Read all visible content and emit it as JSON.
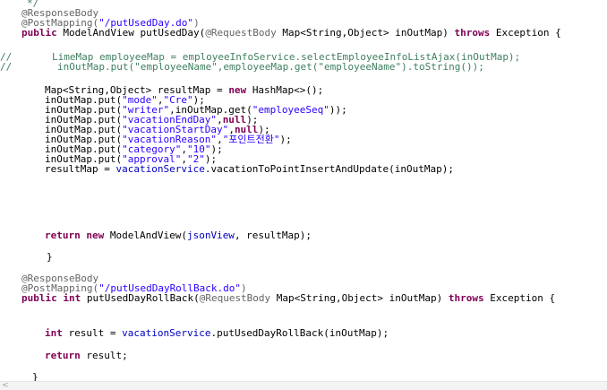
{
  "editor": {
    "language": "java",
    "colors": {
      "background": "#ffffff",
      "annotation": "#646464",
      "keyword": "#7f0055",
      "string": "#2a00ff",
      "comment": "#3f7f5f",
      "field": "#0000c0",
      "plain": "#000000"
    },
    "lines": [
      [
        {
          "t": "comment",
          "v": "*/"
        }
      ],
      [
        {
          "t": "annotation",
          "v": "@ResponseBody"
        }
      ],
      [
        {
          "t": "annotation",
          "v": "@PostMapping("
        },
        {
          "t": "string",
          "v": "\"/putUsedDay.do\""
        },
        {
          "t": "annotation",
          "v": ")"
        }
      ],
      [
        {
          "t": "keyword",
          "v": "public "
        },
        {
          "t": "plain",
          "v": "ModelAndView putUsedDay("
        },
        {
          "t": "annotation",
          "v": "@RequestBody "
        },
        {
          "t": "plain",
          "v": "Map<String,Object> "
        },
        {
          "t": "plain",
          "v": "inOutMap) "
        },
        {
          "t": "keyword",
          "v": "throws "
        },
        {
          "t": "plain",
          "v": "Exception {"
        }
      ],
      [],
      [
        {
          "t": "comment",
          "v": "LimeMap employeeMap = employeeInfoService.selectEmployeeInfoListAjax(inOutMap);"
        }
      ],
      [
        {
          "t": "comment",
          "v": "inOutMap.put(\"employeeName\",employeeMap.get(\"employeeName\").toString());"
        }
      ],
      [],
      [
        {
          "t": "plain",
          "v": "Map<String,Object> resultMap = "
        },
        {
          "t": "keyword",
          "v": "new "
        },
        {
          "t": "plain",
          "v": "HashMap<>();"
        }
      ],
      [
        {
          "t": "plain",
          "v": "inOutMap.put("
        },
        {
          "t": "string",
          "v": "\"mode\""
        },
        {
          "t": "plain",
          "v": ","
        },
        {
          "t": "string",
          "v": "\"Cre\""
        },
        {
          "t": "plain",
          "v": ");"
        }
      ],
      [
        {
          "t": "plain",
          "v": "inOutMap.put("
        },
        {
          "t": "string",
          "v": "\"writer\""
        },
        {
          "t": "plain",
          "v": ",inOutMap.get("
        },
        {
          "t": "string",
          "v": "\"employeeSeq\""
        },
        {
          "t": "plain",
          "v": "));"
        }
      ],
      [
        {
          "t": "plain",
          "v": "inOutMap.put("
        },
        {
          "t": "string",
          "v": "\"vacationEndDay\""
        },
        {
          "t": "plain",
          "v": ","
        },
        {
          "t": "keyword",
          "v": "null"
        },
        {
          "t": "plain",
          "v": ");"
        }
      ],
      [
        {
          "t": "plain",
          "v": "inOutMap.put("
        },
        {
          "t": "string",
          "v": "\"vacationStartDay\""
        },
        {
          "t": "plain",
          "v": ","
        },
        {
          "t": "keyword",
          "v": "null"
        },
        {
          "t": "plain",
          "v": ");"
        }
      ],
      [
        {
          "t": "plain",
          "v": "inOutMap.put("
        },
        {
          "t": "string",
          "v": "\"vacationReason\""
        },
        {
          "t": "plain",
          "v": ","
        },
        {
          "t": "string",
          "v": "\"포인트전환\""
        },
        {
          "t": "plain",
          "v": ");"
        }
      ],
      [
        {
          "t": "plain",
          "v": "inOutMap.put("
        },
        {
          "t": "string",
          "v": "\"category\""
        },
        {
          "t": "plain",
          "v": ","
        },
        {
          "t": "string",
          "v": "\"10\""
        },
        {
          "t": "plain",
          "v": ");"
        }
      ],
      [
        {
          "t": "plain",
          "v": "inOutMap.put("
        },
        {
          "t": "string",
          "v": "\"approval\""
        },
        {
          "t": "plain",
          "v": ","
        },
        {
          "t": "string",
          "v": "\"2\""
        },
        {
          "t": "plain",
          "v": ");"
        }
      ],
      [
        {
          "t": "plain",
          "v": "resultMap = "
        },
        {
          "t": "field",
          "v": "vacationService"
        },
        {
          "t": "plain",
          "v": ".vacationToPointInsertAndUpdate(inOutMap);"
        }
      ],
      [
        {
          "t": "keyword",
          "v": "return new "
        },
        {
          "t": "plain",
          "v": "ModelAndView("
        },
        {
          "t": "field",
          "v": "jsonView"
        },
        {
          "t": "plain",
          "v": ", resultMap);"
        }
      ],
      [
        {
          "t": "plain",
          "v": "}"
        }
      ],
      [
        {
          "t": "annotation",
          "v": "@ResponseBody"
        }
      ],
      [
        {
          "t": "annotation",
          "v": "@PostMapping("
        },
        {
          "t": "string",
          "v": "\"/putUsedDayRollBack.do\""
        },
        {
          "t": "annotation",
          "v": ")"
        }
      ],
      [
        {
          "t": "keyword",
          "v": "public int "
        },
        {
          "t": "plain",
          "v": "putUsedDayRollBack("
        },
        {
          "t": "annotation",
          "v": "@RequestBody "
        },
        {
          "t": "plain",
          "v": "Map<String,Object> "
        },
        {
          "t": "plain",
          "v": "inOutMap) "
        },
        {
          "t": "keyword",
          "v": "throws "
        },
        {
          "t": "plain",
          "v": "Exception {"
        }
      ],
      [
        {
          "t": "keyword",
          "v": "int "
        },
        {
          "t": "plain",
          "v": "result = "
        },
        {
          "t": "field",
          "v": "vacationService"
        },
        {
          "t": "plain",
          "v": ".putUsedDayRollBack(inOutMap);"
        }
      ],
      [
        {
          "t": "keyword",
          "v": "return "
        },
        {
          "t": "plain",
          "v": "result;"
        }
      ],
      [
        {
          "t": "plain",
          "v": "}"
        }
      ]
    ],
    "gutter_marks": [
      "//",
      "//"
    ]
  },
  "scrollbar": {
    "left_arrow_glyph": "<"
  }
}
